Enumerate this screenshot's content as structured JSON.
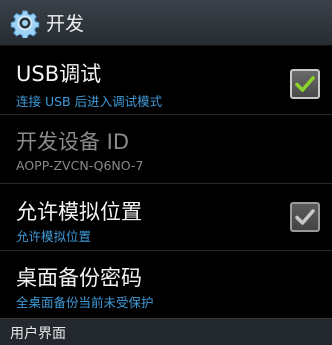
{
  "action_bar": {
    "icon": "settings-gear-icon",
    "title": "开发"
  },
  "preferences": [
    {
      "title": "USB调试",
      "summary": "连接 USB 后进入调试模式",
      "checkbox": true,
      "checked": true,
      "enabled": true
    },
    {
      "title": "开发设备 ID",
      "summary": "AOPP-ZVCN-Q6NO-7",
      "checkbox": false,
      "enabled": false
    },
    {
      "title": "允许模拟位置",
      "summary": "允许模拟位置",
      "checkbox": true,
      "checked": true,
      "enabled": false
    },
    {
      "title": "桌面备份密码",
      "summary": "全桌面备份当前未受保护",
      "checkbox": false,
      "enabled": true
    }
  ],
  "section_header": {
    "label": "用户界面"
  },
  "colors": {
    "summary_blue": "#3f9ad8",
    "check_green": "#8cd22c",
    "check_gray": "#c8c8c8"
  }
}
